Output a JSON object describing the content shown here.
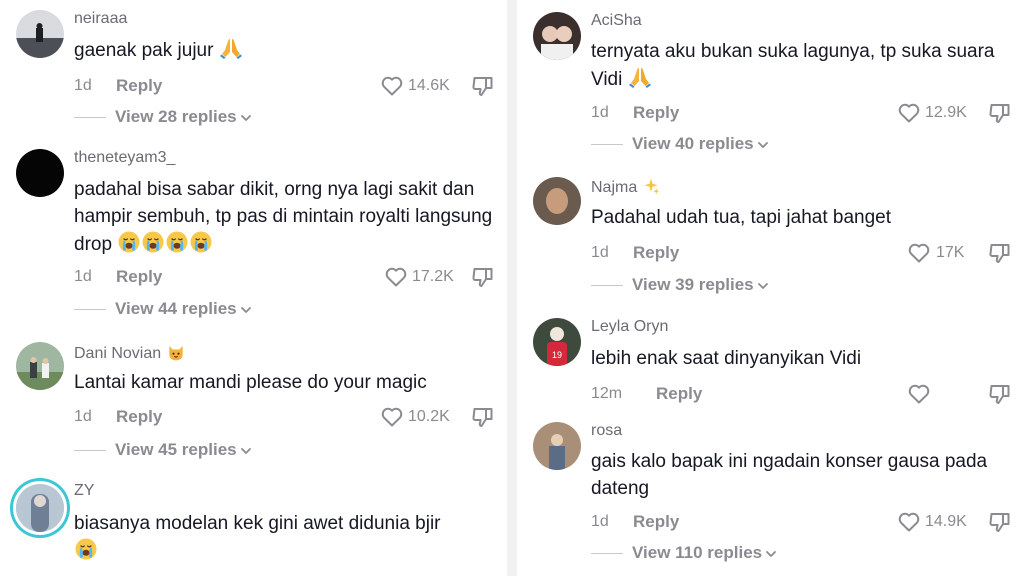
{
  "left": [
    {
      "username": "neiraaa",
      "text": "gaenak pak jujur",
      "emoji": [
        "pray"
      ],
      "time": "1d",
      "reply": "Reply",
      "likes": "14.6K",
      "view_replies": "View 28 replies"
    },
    {
      "username": "theneteyam3_",
      "text": "padahal bisa sabar dikit, orng nya lagi sakit dan hampir sembuh, tp pas di mintain royalti langsung drop",
      "emoji": [
        "cry",
        "cry",
        "cry",
        "cry"
      ],
      "time": "1d",
      "reply": "Reply",
      "likes": "17.2K",
      "view_replies": "View 44 replies"
    },
    {
      "username": "Dani Novian",
      "username_emoji": "cat",
      "text": "Lantai kamar mandi please do your magic",
      "time": "1d",
      "reply": "Reply",
      "likes": "10.2K",
      "view_replies": "View 45 replies"
    },
    {
      "username": "ZY",
      "text": "biasanya modelan kek gini awet didunia bjir",
      "emoji": [
        "cry"
      ]
    }
  ],
  "right": [
    {
      "username": "AciSha",
      "text": "ternyata aku bukan suka lagunya, tp suka suara Vidi",
      "emoji": [
        "pray"
      ],
      "time": "1d",
      "reply": "Reply",
      "likes": "12.9K",
      "view_replies": "View 40 replies"
    },
    {
      "username": "Najma",
      "username_emoji": "sparkles",
      "text": "Padahal udah tua, tapi jahat banget",
      "time": "1d",
      "reply": "Reply",
      "likes": "17K",
      "view_replies": "View 39 replies"
    },
    {
      "username": "Leyla Oryn",
      "text": "lebih enak saat dinyanyikan Vidi",
      "time": "12m",
      "reply": "Reply",
      "likes": ""
    },
    {
      "username": "rosa",
      "text": "gais kalo bapak ini ngadain konser gausa pada dateng",
      "time": "1d",
      "reply": "Reply",
      "likes": "14.9K",
      "view_replies": "View 110 replies"
    }
  ],
  "colors": {
    "text": "#161823",
    "muted": "#8a8b91",
    "ring": "#3cc6d6",
    "heart": "#8a8b91"
  }
}
